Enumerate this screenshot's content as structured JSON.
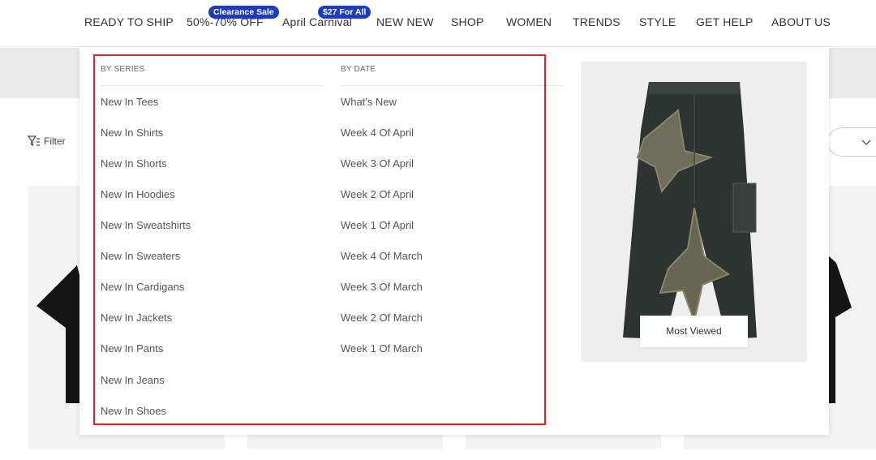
{
  "nav": {
    "items": [
      "READY TO SHIP",
      "50%-70% OFF",
      "April Carnival",
      "NEW NEW",
      "SHOP",
      "WOMEN",
      "TRENDS",
      "STYLE",
      "GET HELP",
      "ABOUT US"
    ],
    "badges": [
      "Clearance Sale",
      "$27 For All"
    ],
    "badge_color": "#1d3bbd"
  },
  "filter": {
    "label": "Filter",
    "icon": "filter-icon"
  },
  "sort": {
    "icon": "chevron-down-icon"
  },
  "menu": {
    "by_series": {
      "heading": "BY SERIES",
      "links": [
        "New In Tees",
        "New In Shirts",
        "New In Shorts",
        "New In Hoodies",
        "New In Sweatshirts",
        "New In Sweaters",
        "New In Cardigans",
        "New In Jackets",
        "New In Pants",
        "New In Jeans",
        "New In Shoes"
      ]
    },
    "by_date": {
      "heading": "BY DATE",
      "links": [
        "What's New",
        "Week 4 Of April",
        "Week 3 Of April",
        "Week 2 Of April",
        "Week 1 Of April",
        "Week 4 Of March",
        "Week 3 Of March",
        "Week 2 Of March",
        "Week 1 Of March"
      ]
    },
    "highlight_color": "#d9262b"
  },
  "feature": {
    "label": "Most Viewed",
    "image": "distressed-denim-jeans-image"
  }
}
